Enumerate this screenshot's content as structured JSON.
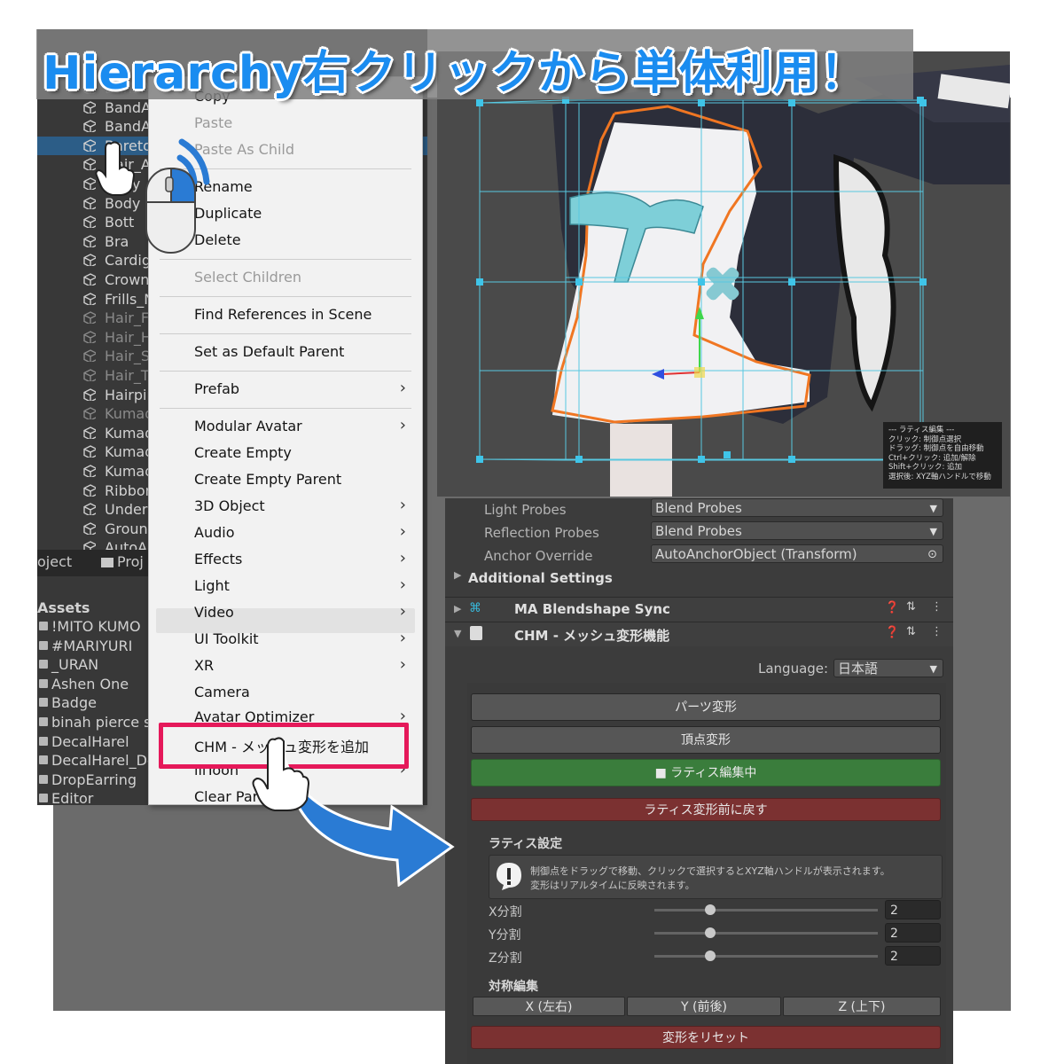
{
  "banner": {
    "title": "Hierarchy右クリックから単体利用！"
  },
  "hierarchy": {
    "items": [
      {
        "label": "BandA",
        "dim": true
      },
      {
        "label": "BandA",
        "dim": false
      },
      {
        "label": "BandA",
        "dim": false
      },
      {
        "label": "Bareto",
        "dim": false,
        "selected": true
      },
      {
        "label": "Hair_A",
        "dim": false
      },
      {
        "label": "Body",
        "dim": false
      },
      {
        "label": "Body",
        "dim": false
      },
      {
        "label": "Bott",
        "dim": false
      },
      {
        "label": "Bra",
        "dim": false
      },
      {
        "label": "Cardig",
        "dim": false
      },
      {
        "label": "Crown",
        "dim": false
      },
      {
        "label": "Frills_N",
        "dim": false
      },
      {
        "label": "Hair_F",
        "dim": true
      },
      {
        "label": "Hair_H",
        "dim": true
      },
      {
        "label": "Hair_S",
        "dim": true
      },
      {
        "label": "Hair_T",
        "dim": true
      },
      {
        "label": "Hairpin",
        "dim": false
      },
      {
        "label": "Kumad",
        "dim": true
      },
      {
        "label": "Kumad",
        "dim": false
      },
      {
        "label": "Kumad",
        "dim": false
      },
      {
        "label": "Kumad",
        "dim": false
      },
      {
        "label": "Ribbon",
        "dim": false
      },
      {
        "label": "Under",
        "dim": false
      },
      {
        "label": "Ground",
        "dim": false
      },
      {
        "label": "AutoA",
        "dim": false
      }
    ]
  },
  "project_tabs": {
    "tab1": "oject",
    "tab2": "Proj"
  },
  "assets": {
    "header": "Assets",
    "items": [
      "!MITO KUMO",
      "#MARIYURI",
      "_URAN",
      "Ashen One",
      "Badge",
      "binah pierce se",
      "DecalHarel",
      "DecalHarel_De",
      "DropEarring",
      "Editor"
    ]
  },
  "context_menu": {
    "items": [
      {
        "label": "Copy",
        "disabled": false,
        "submenu": false
      },
      {
        "label": "Paste",
        "disabled": true,
        "submenu": false
      },
      {
        "label": "Paste As Child",
        "disabled": true,
        "submenu": false
      },
      {
        "label": "Rename",
        "disabled": false,
        "submenu": false
      },
      {
        "label": "Duplicate",
        "disabled": false,
        "submenu": false
      },
      {
        "label": "Delete",
        "disabled": false,
        "submenu": false
      },
      {
        "label": "Select Children",
        "disabled": true,
        "submenu": false
      },
      {
        "label": "Find References in Scene",
        "disabled": false,
        "submenu": false
      },
      {
        "label": "Set as Default Parent",
        "disabled": false,
        "submenu": false
      },
      {
        "label": "Prefab",
        "disabled": false,
        "submenu": true
      },
      {
        "label": "Modular Avatar",
        "disabled": false,
        "submenu": true
      },
      {
        "label": "Create Empty",
        "disabled": false,
        "submenu": false
      },
      {
        "label": "Create Empty Parent",
        "disabled": false,
        "submenu": false
      },
      {
        "label": "3D Object",
        "disabled": false,
        "submenu": true
      },
      {
        "label": "Audio",
        "disabled": false,
        "submenu": true
      },
      {
        "label": "Effects",
        "disabled": false,
        "submenu": true
      },
      {
        "label": "Light",
        "disabled": false,
        "submenu": true
      },
      {
        "label": "Video",
        "disabled": false,
        "submenu": true,
        "highlighted": true
      },
      {
        "label": "UI Toolkit",
        "disabled": false,
        "submenu": true
      },
      {
        "label": "XR",
        "disabled": false,
        "submenu": true
      },
      {
        "label": "Camera",
        "disabled": false,
        "submenu": false
      },
      {
        "label": "Avatar Optimizer",
        "disabled": false,
        "submenu": true
      },
      {
        "label": "CHM - メッシュ変形を追加",
        "disabled": false,
        "submenu": false,
        "emphasized": true
      },
      {
        "label": "lilToon",
        "disabled": false,
        "submenu": true
      },
      {
        "label": "Clear Parent",
        "disabled": false,
        "submenu": false
      }
    ]
  },
  "scene_info": {
    "lines": [
      "--- ラティス編集 ---",
      "クリック: 制御点選択",
      "ドラッグ: 制御点を自由移動",
      "Ctrl+クリック: 追加/解除",
      "Shift+クリック: 追加",
      "選択後: XYZ軸ハンドルで移動"
    ]
  },
  "inspector": {
    "light_probes_label": "Light Probes",
    "light_probes_value": "Blend Probes",
    "reflection_probes_label": "Reflection Probes",
    "reflection_probes_value": "Blend Probes",
    "anchor_override_label": "Anchor Override",
    "anchor_override_value": "AutoAnchorObject (Transform)",
    "additional_settings": "Additional Settings",
    "component1_title": "MA Blendshape Sync",
    "component2_title": "CHM - メッシュ変形機能",
    "language_label": "Language:",
    "language_value": "日本語",
    "btn_parts": "パーツ変形",
    "btn_vertex": "頂点変形",
    "btn_lattice_editing": "■ ラティス編集中",
    "btn_lattice_revert": "ラティス変形前に戻す",
    "lattice_settings_title": "ラティス設定",
    "help_line1": "制御点をドラッグで移動、クリックで選択するとXYZ軸ハンドルが表示されます。",
    "help_line2": "変形はリアルタイムに反映されます。",
    "x_div_label": "X分割",
    "y_div_label": "Y分割",
    "z_div_label": "Z分割",
    "x_div_value": "2",
    "y_div_value": "2",
    "z_div_value": "2",
    "x_div_level": 0.25,
    "y_div_level": 0.25,
    "z_div_level": 0.25,
    "symmetry_title": "対称編集",
    "sym_x": "X (左右)",
    "sym_y": "Y (前後)",
    "sym_z": "Z (上下)",
    "btn_reset": "変形をリセット"
  },
  "colors": {
    "banner_text": "#1a8cf0",
    "highlight_box": "#e5195a",
    "green_button": "#3a7d3c",
    "red_button": "#7b3131",
    "arrow_blue": "#2a7bd4"
  }
}
